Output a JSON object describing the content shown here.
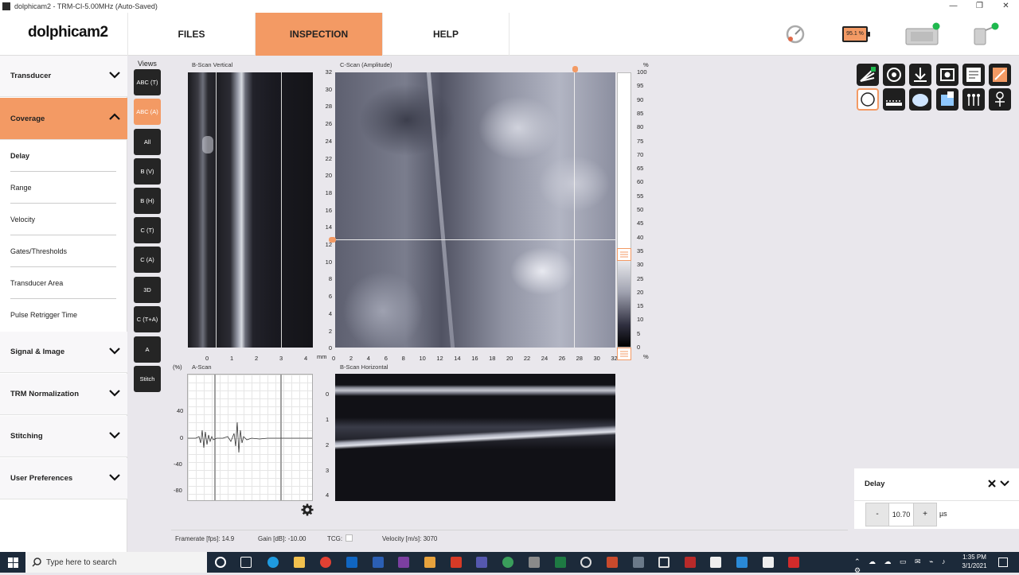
{
  "window": {
    "title": "dolphicam2 - TRM-CI-5.00MHz (Auto-Saved)",
    "controls": [
      "—",
      "❐",
      "✕"
    ]
  },
  "header": {
    "logo": "dolphicam2",
    "tabs": [
      {
        "label": "FILES"
      },
      {
        "label": "INSPECTION"
      },
      {
        "label": "HELP"
      }
    ],
    "battery_label": "95.1 %"
  },
  "sidebar": {
    "sections": [
      {
        "label": "Transducer"
      },
      {
        "label": "Coverage"
      },
      {
        "label": "Signal & Image"
      },
      {
        "label": "TRM Normalization"
      },
      {
        "label": "Stitching"
      },
      {
        "label": "User Preferences"
      }
    ],
    "coverage_items": [
      {
        "label": "Delay"
      },
      {
        "label": "Range"
      },
      {
        "label": "Velocity"
      },
      {
        "label": "Gates/Thresholds"
      },
      {
        "label": "Transducer Area"
      },
      {
        "label": "Pulse Retrigger Time"
      }
    ]
  },
  "views": {
    "label": "Views",
    "buttons": [
      "ABC (T)",
      "ABC (A)",
      "All",
      "B (V)",
      "B (H)",
      "C (T)",
      "C (A)",
      "3D",
      "C (T+A)",
      "A",
      "Stitch"
    ]
  },
  "panels": {
    "bscan_vertical": {
      "title": "B-Scan Vertical",
      "xticks": [
        "0",
        "1",
        "2",
        "3",
        "4"
      ]
    },
    "cscan": {
      "title": "C-Scan (Amplitude)",
      "yticks": [
        "32",
        "30",
        "28",
        "26",
        "24",
        "22",
        "20",
        "18",
        "16",
        "14",
        "12",
        "10",
        "8",
        "6",
        "4",
        "2",
        "0"
      ],
      "xticks": [
        "0",
        "2",
        "4",
        "6",
        "8",
        "10",
        "12",
        "14",
        "16",
        "18",
        "20",
        "22",
        "24",
        "26",
        "28",
        "30",
        "32"
      ],
      "unit": "mm",
      "scale_ticks": [
        "100",
        "95",
        "90",
        "85",
        "80",
        "75",
        "70",
        "65",
        "60",
        "55",
        "50",
        "45",
        "40",
        "35",
        "30",
        "25",
        "20",
        "15",
        "10",
        "5",
        "0"
      ],
      "scale_unit": "%"
    },
    "ascan": {
      "title": "A-Scan",
      "unit": "(%)",
      "yticks": [
        "40",
        "0",
        "-40",
        "-80"
      ]
    },
    "bscan_horizontal": {
      "title": "B-Scan Horizontal",
      "yticks": [
        "0",
        "1",
        "2",
        "3",
        "4"
      ]
    }
  },
  "status": {
    "framerate": "Framerate [fps]: 14.9",
    "gain": "Gain [dB]: -10.00",
    "tcg": "TCG:",
    "velocity": "Velocity [m/s]: 3070"
  },
  "delay_panel": {
    "title": "Delay",
    "minus": "-",
    "value": "10.70",
    "plus": "+",
    "unit": "µs"
  },
  "taskbar": {
    "search_placeholder": "Type here to search",
    "time": "1:35 PM",
    "date": "3/1/2021"
  }
}
